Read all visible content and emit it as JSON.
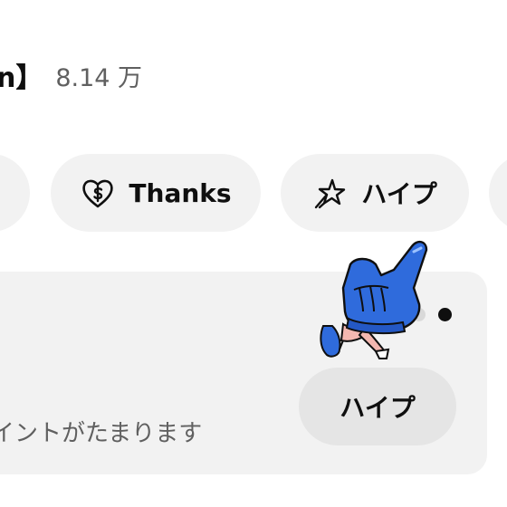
{
  "header": {
    "title_tail": "n】",
    "subscriber_count": "8.14 万"
  },
  "actions": {
    "thanks_label": "Thanks",
    "hype_chip_label": "ハイプ",
    "thanks_icon": "heart-dollar-icon",
    "hype_icon": "sparkle-star-icon"
  },
  "card": {
    "description": "イントがたまります",
    "hype_button_label": "ハイプ",
    "pager": {
      "count": 2,
      "active_index": 1
    }
  },
  "colors": {
    "chip_bg": "#f2f2f2",
    "card_bg": "#f2f2f2",
    "button_bg": "#e5e5e5",
    "mascot_blue": "#2f6bdc",
    "text_primary": "#0f0f0f",
    "text_secondary": "#606060"
  }
}
